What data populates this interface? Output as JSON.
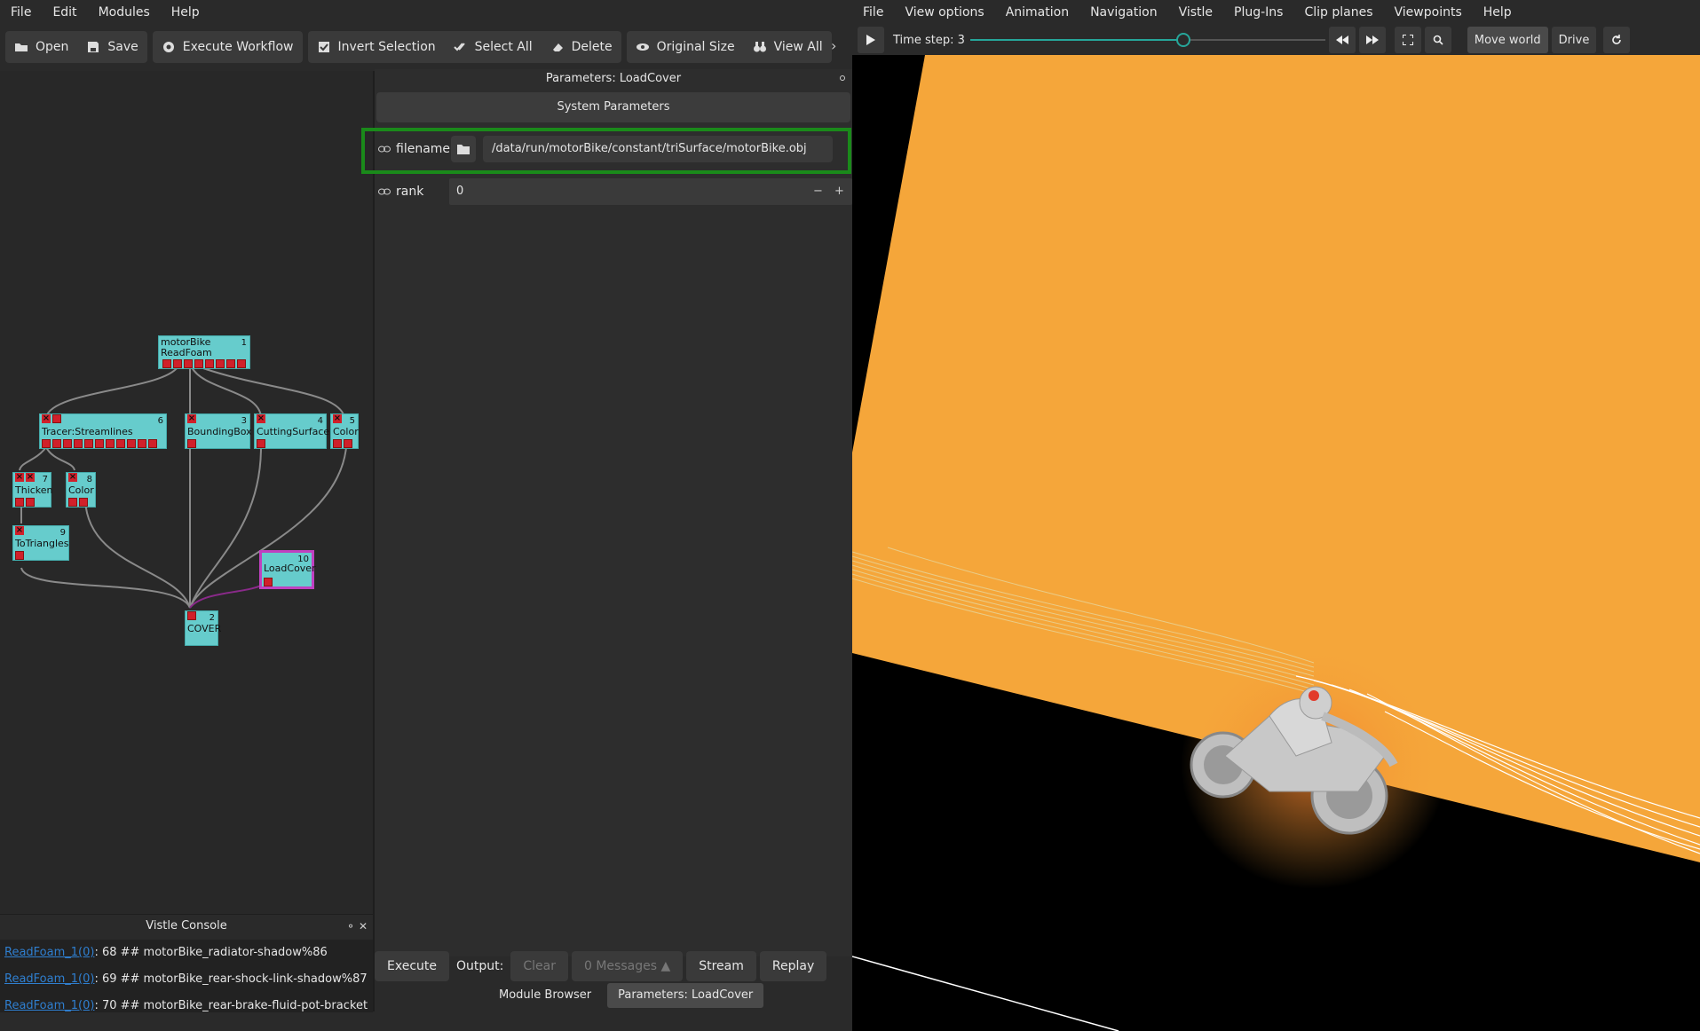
{
  "left_menu": [
    "File",
    "Edit",
    "Modules",
    "Help"
  ],
  "toolbar": {
    "open": "Open",
    "save": "Save",
    "execute_workflow": "Execute Workflow",
    "invert_selection": "Invert Selection",
    "select_all": "Select All",
    "delete": "Delete",
    "original_size": "Original Size",
    "view_all": "View All",
    "more": "›"
  },
  "modules": [
    {
      "name": "motorBike",
      "sub": "ReadFoam",
      "id": "1"
    },
    {
      "name": "Tracer:Streamlines",
      "id": "6"
    },
    {
      "name": "BoundingBox",
      "id": "3"
    },
    {
      "name": "CuttingSurface",
      "id": "4"
    },
    {
      "name": "Color",
      "id": "5"
    },
    {
      "name": "Thicken",
      "id": "7"
    },
    {
      "name": "Color",
      "id": "8"
    },
    {
      "name": "ToTriangles",
      "id": "9"
    },
    {
      "name": "LoadCover",
      "id": "10"
    },
    {
      "name": "COVER",
      "id": "2"
    }
  ],
  "params": {
    "title": "Parameters: LoadCover",
    "system_parameters": "System Parameters",
    "filename_label": "filename",
    "filename_value": "/data/run/motorBike/constant/triSurface/motorBike.obj",
    "rank_label": "rank",
    "rank_value": "0",
    "minus": "−",
    "plus": "+"
  },
  "bottom": {
    "execute": "Execute",
    "output_label": "Output:",
    "clear": "Clear",
    "messages": "0 Messages ▲",
    "stream": "Stream",
    "replay": "Replay"
  },
  "tabs": {
    "module_browser": "Module Browser",
    "parameters": "Parameters: LoadCover"
  },
  "console": {
    "title": "Vistle Console",
    "lines": [
      {
        "link": "ReadFoam_1(0)",
        "text": ": 68 ## motorBike_radiator-shadow%86"
      },
      {
        "link": "ReadFoam_1(0)",
        "text": ": 69 ## motorBike_rear-shock-link-shadow%87"
      },
      {
        "link": "ReadFoam_1(0)",
        "text": ": 70 ## motorBike_rear-brake-fluid-pot-bracket"
      }
    ]
  },
  "right_menu": [
    "File",
    "View options",
    "Animation",
    "Navigation",
    "Vistle",
    "Plug-Ins",
    "Clip planes",
    "Viewpoints",
    "Help"
  ],
  "cover_toolbar": {
    "timestep": "Time step: 3",
    "timestep_fraction": 0.6,
    "move_world": "Move world",
    "drive": "Drive"
  },
  "colors": {
    "accent": "#26a69a",
    "module": "#66cccc",
    "port": "#d0202a",
    "selected": "#c040c0",
    "highlight": "#1a8a1a",
    "scene": "#f5a63a"
  }
}
